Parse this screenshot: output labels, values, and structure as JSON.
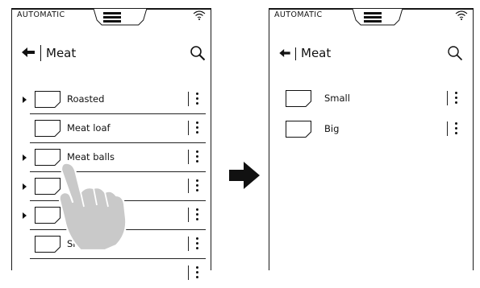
{
  "left_screen": {
    "status": "AUTOMATIC",
    "title": "Meat",
    "items": [
      {
        "label": "Roasted",
        "expandable": true
      },
      {
        "label": "Meat loaf",
        "expandable": false
      },
      {
        "label": "Meat balls",
        "expandable": true
      },
      {
        "label": "",
        "expandable": true
      },
      {
        "label": "",
        "expandable": true
      },
      {
        "label": "Skewers",
        "expandable": false
      },
      {
        "label": "",
        "expandable": false
      }
    ]
  },
  "right_screen": {
    "status": "AUTOMATIC",
    "title": "Meat",
    "items": [
      {
        "label": "Small"
      },
      {
        "label": "Big"
      }
    ]
  },
  "icons": {
    "back": "back-arrow-icon",
    "search": "search-icon",
    "menu": "hamburger-menu-icon",
    "wifi": "wifi-icon",
    "folder": "folder-icon",
    "more": "more-vertical-icon",
    "transition": "right-arrow-icon",
    "gesture": "tapping-hand-icon"
  },
  "colors": {
    "ink": "#111111",
    "hand_fill": "#c9c9c9",
    "background": "#ffffff"
  }
}
